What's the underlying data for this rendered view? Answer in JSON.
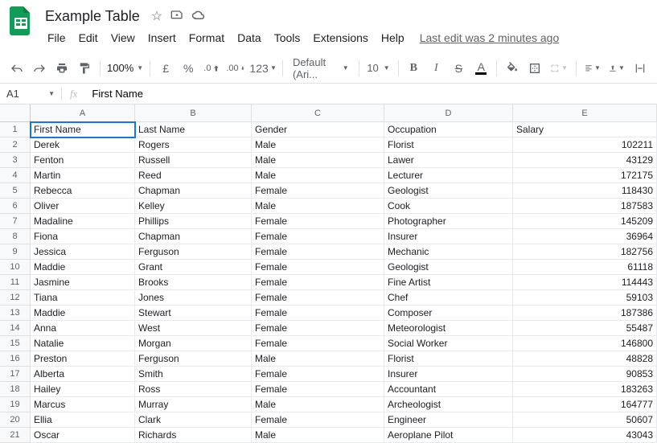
{
  "doc": {
    "title": "Example Table",
    "last_edit": "Last edit was 2 minutes ago"
  },
  "menubar": {
    "file": "File",
    "edit": "Edit",
    "view": "View",
    "insert": "Insert",
    "format": "Format",
    "data": "Data",
    "tools": "Tools",
    "extensions": "Extensions",
    "help": "Help"
  },
  "toolbar": {
    "zoom": "100%",
    "currency": "£",
    "percent": "%",
    "dec_dec": ".0",
    "inc_dec": ".00",
    "more_formats": "123",
    "font": "Default (Ari...",
    "font_size": "10",
    "bold": "B",
    "italic": "I",
    "strike": "S",
    "textcolor": "A"
  },
  "formula_bar": {
    "name_box": "A1",
    "fx": "fx",
    "value": "First Name"
  },
  "columns": [
    "A",
    "B",
    "C",
    "D",
    "E"
  ],
  "rows": [
    "1",
    "2",
    "3",
    "4",
    "5",
    "6",
    "7",
    "8",
    "9",
    "10",
    "11",
    "12",
    "13",
    "14",
    "15",
    "16",
    "17",
    "18",
    "19",
    "20",
    "21"
  ],
  "headers": [
    "First Name",
    "Last Name",
    "Gender",
    "Occupation",
    "Salary"
  ],
  "data": [
    [
      "Derek",
      "Rogers",
      "Male",
      "Florist",
      "102211"
    ],
    [
      "Fenton",
      "Russell",
      "Male",
      "Lawer",
      "43129"
    ],
    [
      "Martin",
      "Reed",
      "Male",
      "Lecturer",
      "172175"
    ],
    [
      "Rebecca",
      "Chapman",
      "Female",
      "Geologist",
      "118430"
    ],
    [
      "Oliver",
      "Kelley",
      "Male",
      "Cook",
      "187583"
    ],
    [
      "Madaline",
      "Phillips",
      "Female",
      "Photographer",
      "145209"
    ],
    [
      "Fiona",
      "Chapman",
      "Female",
      "Insurer",
      "36964"
    ],
    [
      "Jessica",
      "Ferguson",
      "Female",
      "Mechanic",
      "182756"
    ],
    [
      "Maddie",
      "Grant",
      "Female",
      "Geologist",
      "61118"
    ],
    [
      "Jasmine",
      "Brooks",
      "Female",
      "Fine Artist",
      "114443"
    ],
    [
      "Tiana",
      "Jones",
      "Female",
      "Chef",
      "59103"
    ],
    [
      "Maddie",
      "Stewart",
      "Female",
      "Composer",
      "187386"
    ],
    [
      "Anna",
      "West",
      "Female",
      "Meteorologist",
      "55487"
    ],
    [
      "Natalie",
      "Morgan",
      "Female",
      "Social Worker",
      "146800"
    ],
    [
      "Preston",
      "Ferguson",
      "Male",
      "Florist",
      "48828"
    ],
    [
      "Alberta",
      "Smith",
      "Female",
      "Insurer",
      "90853"
    ],
    [
      "Hailey",
      "Ross",
      "Female",
      "Accountant",
      "183263"
    ],
    [
      "Marcus",
      "Murray",
      "Male",
      "Archeologist",
      "164777"
    ],
    [
      "Ellia",
      "Clark",
      "Female",
      "Engineer",
      "50607"
    ],
    [
      "Oscar",
      "Richards",
      "Male",
      "Aeroplane Pilot",
      "43043"
    ]
  ]
}
